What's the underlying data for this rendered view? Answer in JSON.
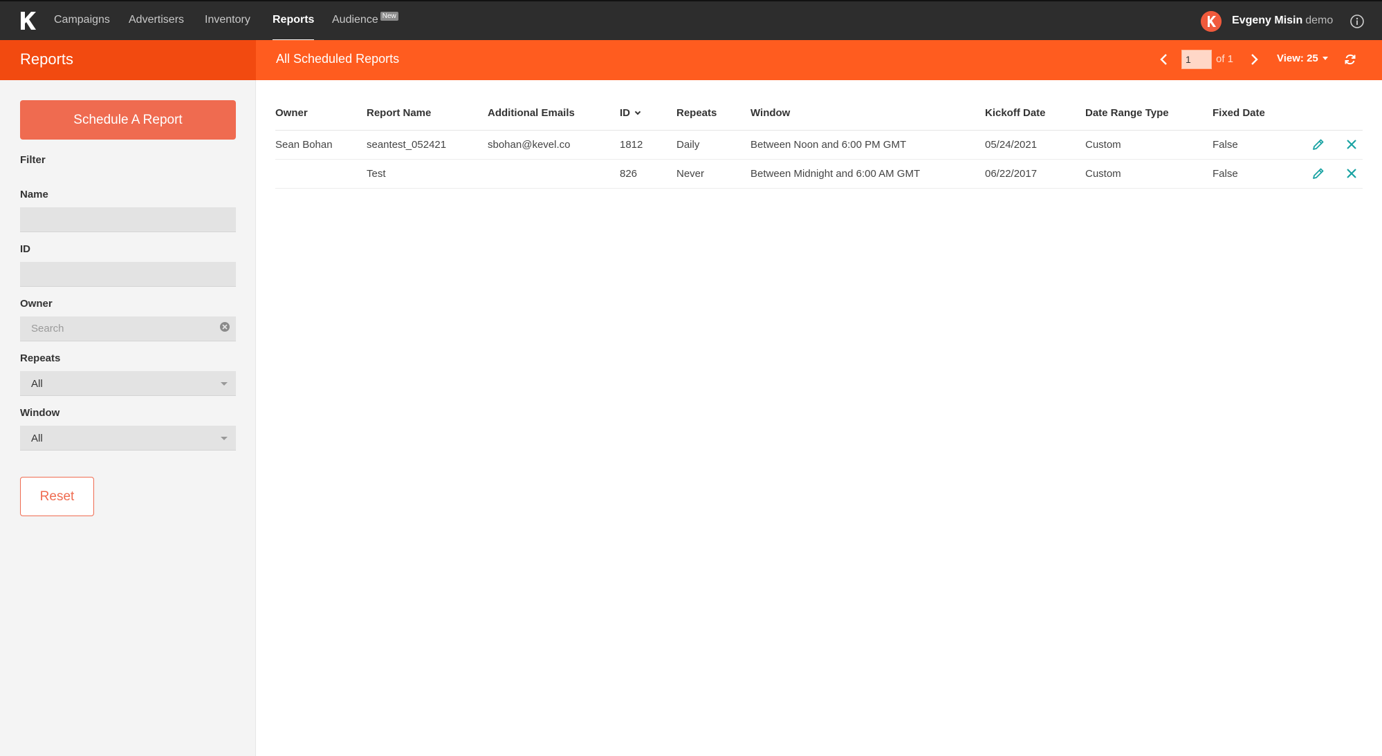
{
  "nav": {
    "items": [
      {
        "label": "Campaigns",
        "active": false
      },
      {
        "label": "Advertisers",
        "active": false
      },
      {
        "label": "Inventory",
        "active": false
      },
      {
        "label": "Reports",
        "active": true
      },
      {
        "label": "Audience",
        "active": false,
        "badge": "New"
      }
    ],
    "user": {
      "name": "Evgeny Misin",
      "role": "demo"
    },
    "icons": {
      "logo": "kevel-logo",
      "info": "info-icon",
      "avatar": "user-avatar"
    }
  },
  "sidebar": {
    "title": "Reports",
    "schedule_button": "Schedule A Report",
    "filter_title": "Filter",
    "fields": {
      "name_label": "Name",
      "name_value": "",
      "id_label": "ID",
      "id_value": "",
      "owner_label": "Owner",
      "owner_placeholder": "Search",
      "repeats_label": "Repeats",
      "repeats_value": "All",
      "window_label": "Window",
      "window_value": "All"
    },
    "reset_button": "Reset"
  },
  "main": {
    "title": "All Scheduled Reports",
    "pager": {
      "page": "1",
      "of_text": "of 1",
      "view_label": "View: 25"
    },
    "table": {
      "headers": [
        "Owner",
        "Report Name",
        "Additional Emails",
        "ID",
        "Repeats",
        "Window",
        "Kickoff Date",
        "Date Range Type",
        "Fixed Date"
      ],
      "sort_column": "ID",
      "rows": [
        [
          "Sean Bohan",
          "seantest_052421",
          "sbohan@kevel.co",
          "1812",
          "Daily",
          "Between Noon and 6:00 PM GMT",
          "05/24/2021",
          "Custom",
          "False"
        ],
        [
          "",
          "Test",
          "",
          "826",
          "Never",
          "Between Midnight and 6:00 AM GMT",
          "06/22/2017",
          "Custom",
          "False"
        ]
      ]
    }
  },
  "colors": {
    "nav_bg": "#2d2d2d",
    "sidebar_header": "#f24a10",
    "main_header": "#ff5c1f",
    "primary_button": "#ef6b50",
    "action_icons": "#1aa3a3"
  }
}
